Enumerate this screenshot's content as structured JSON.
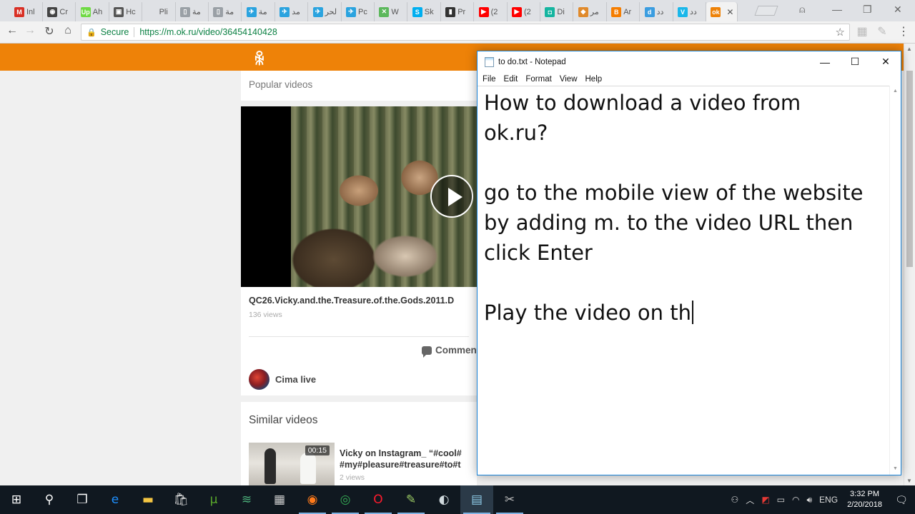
{
  "browser": {
    "tabs": [
      {
        "label": "Inl",
        "icon": "gmail-icon",
        "color": "#d93025",
        "glyph": "M"
      },
      {
        "label": "Cr",
        "icon": "camera-icon",
        "color": "#444444",
        "glyph": "◉"
      },
      {
        "label": "Ah",
        "icon": "upwork-icon",
        "color": "#6fda44",
        "glyph": "Up"
      },
      {
        "label": "Hc",
        "icon": "bookmark-icon",
        "color": "#555555",
        "glyph": "▣"
      },
      {
        "label": "Pli",
        "icon": "blank-page-icon",
        "color": "#dfe1e5",
        "glyph": ""
      },
      {
        "label": "مة",
        "icon": "document-icon",
        "color": "#9aa0a6",
        "glyph": "▯"
      },
      {
        "label": "مة",
        "icon": "document-icon",
        "color": "#9aa0a6",
        "glyph": "▯"
      },
      {
        "label": "مة",
        "icon": "telegram-icon",
        "color": "#2aa3df",
        "glyph": "✈"
      },
      {
        "label": "مد",
        "icon": "telegram-icon",
        "color": "#2aa3df",
        "glyph": "✈"
      },
      {
        "label": "لحر",
        "icon": "telegram-icon",
        "color": "#2aa3df",
        "glyph": "✈"
      },
      {
        "label": "Pc",
        "icon": "telegram-icon",
        "color": "#2aa3df",
        "glyph": "✈"
      },
      {
        "label": "W",
        "icon": "whatsapp-like-icon",
        "color": "#5cb85c",
        "glyph": "✕"
      },
      {
        "label": "Sk",
        "icon": "skype-icon",
        "color": "#00aff0",
        "glyph": "S"
      },
      {
        "label": "Pr",
        "icon": "phone-icon",
        "color": "#333333",
        "glyph": "▮"
      },
      {
        "label": "(2",
        "icon": "youtube-icon",
        "color": "#ff0000",
        "glyph": "▶"
      },
      {
        "label": "(2",
        "icon": "youtube-icon",
        "color": "#ff0000",
        "glyph": "▶"
      },
      {
        "label": "Di",
        "icon": "app-icon",
        "color": "#15b5a0",
        "glyph": "◘"
      },
      {
        "label": "مر",
        "icon": "image-icon",
        "color": "#e08a2c",
        "glyph": "◆"
      },
      {
        "label": "Ar",
        "icon": "blogger-icon",
        "color": "#f57d00",
        "glyph": "B"
      },
      {
        "label": "دد",
        "icon": "app-icon",
        "color": "#3b9de0",
        "glyph": "d"
      },
      {
        "label": "دد",
        "icon": "vimeo-icon",
        "color": "#1ab7ea",
        "glyph": "V"
      },
      {
        "label": "",
        "icon": "ok-ru-icon",
        "color": "#ee8208",
        "glyph": "ok",
        "active": true
      }
    ],
    "address": {
      "secure_label": "Secure",
      "url": "https://m.ok.ru/video/36454140428"
    }
  },
  "okru": {
    "brand_color": "#ee8208",
    "popular_heading": "Popular videos",
    "video_title": "QC26.Vicky.and.the.Treasure.of.the.Gods.2011.D",
    "video_views": "136 views",
    "comments_label": "Commen",
    "channel_name": "Cima live",
    "similar_heading": "Similar videos",
    "similar_item": {
      "duration": "00:15",
      "title_line1": "Vicky on Instagram_ “#cool#",
      "title_line2": "#my#pleasure#treasure#to#t",
      "views": "2 views"
    }
  },
  "notepad": {
    "title": "to do.txt - Notepad",
    "menu": [
      "File",
      "Edit",
      "Format",
      "View",
      "Help"
    ],
    "lines": [
      "How to download a video from",
      "ok.ru?",
      "",
      "go to the mobile view of the website",
      "by adding m. to the video URL then",
      "click Enter",
      "",
      "Play the video on th"
    ]
  },
  "taskbar": {
    "apps": [
      {
        "name": "start-button",
        "color": "#ffffff"
      },
      {
        "name": "search-button",
        "color": "#ffffff"
      },
      {
        "name": "task-view-button",
        "color": "#ffffff"
      },
      {
        "name": "edge-browser",
        "color": "#1e90ff"
      },
      {
        "name": "file-explorer",
        "color": "#f4c542"
      },
      {
        "name": "store",
        "color": "#dddddd"
      },
      {
        "name": "utorrent",
        "color": "#5aa92b"
      },
      {
        "name": "layers-app",
        "color": "#4caf7a"
      },
      {
        "name": "calculator",
        "color": "#cccccc"
      },
      {
        "name": "firefox",
        "color": "#ff7a1a"
      },
      {
        "name": "chrome",
        "color": "#34a853"
      },
      {
        "name": "opera",
        "color": "#ff1b2d"
      },
      {
        "name": "notepad-plus",
        "color": "#9ccc65"
      },
      {
        "name": "media-app",
        "color": "#cfd8dc"
      },
      {
        "name": "notepad",
        "color": "#8ecae6"
      },
      {
        "name": "snipping-tool",
        "color": "#bbbbbb"
      }
    ],
    "language": "ENG",
    "time": "3:32 PM",
    "date": "2/20/2018"
  }
}
